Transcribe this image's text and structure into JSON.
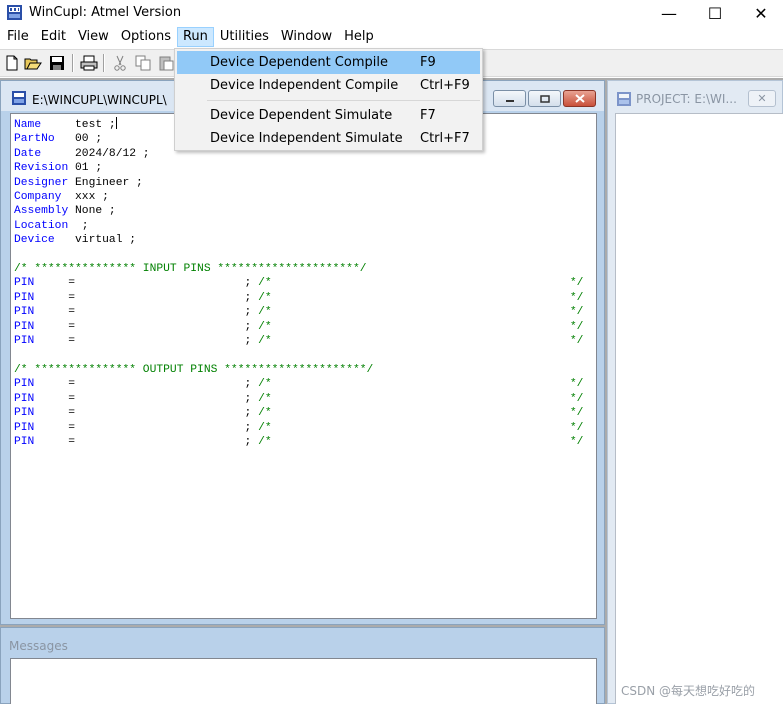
{
  "window": {
    "title": "WinCupl:  Atmel Version",
    "minimize": "—",
    "maximize": "☐",
    "close": "✕"
  },
  "menu": {
    "items": [
      "File",
      "Edit",
      "View",
      "Options",
      "Run",
      "Utilities",
      "Window",
      "Help"
    ],
    "active": "Run"
  },
  "run_menu": {
    "items": [
      {
        "label": "Device Dependent Compile",
        "shortcut": "F9"
      },
      {
        "label": "Device Independent Compile",
        "shortcut": "Ctrl+F9"
      },
      {
        "label": "Device Dependent Simulate",
        "shortcut": "F7"
      },
      {
        "label": "Device Independent Simulate",
        "shortcut": "Ctrl+F7"
      }
    ],
    "highlighted": "Device Dependent Compile"
  },
  "editor": {
    "title": "E:\\WINCUPL\\WINCUPL\\",
    "header": [
      {
        "key": "Name",
        "value": "test ;"
      },
      {
        "key": "PartNo",
        "value": "00 ;"
      },
      {
        "key": "Date",
        "value": "2024/8/12 ;"
      },
      {
        "key": "Revision",
        "value": "01 ;"
      },
      {
        "key": "Designer",
        "value": "Engineer ;"
      },
      {
        "key": "Company",
        "value": "xxx ;"
      },
      {
        "key": "Assembly",
        "value": "None ;"
      },
      {
        "key": "Location",
        "value": " ;"
      },
      {
        "key": "Device",
        "value": "virtual ;"
      }
    ],
    "input_comment": "/* *************** INPUT PINS *********************/",
    "output_comment": "/* *************** OUTPUT PINS *********************/",
    "pin_keyword": "PIN",
    "pin_eq": "=",
    "pin_semicolon": ";",
    "pin_comment_open": "/*",
    "pin_comment_close": "*/"
  },
  "messages": {
    "title": "Messages"
  },
  "project": {
    "title": "PROJECT: E:\\WI...",
    "close": "✕"
  },
  "watermark": "CSDN @每天想吃好吃的"
}
